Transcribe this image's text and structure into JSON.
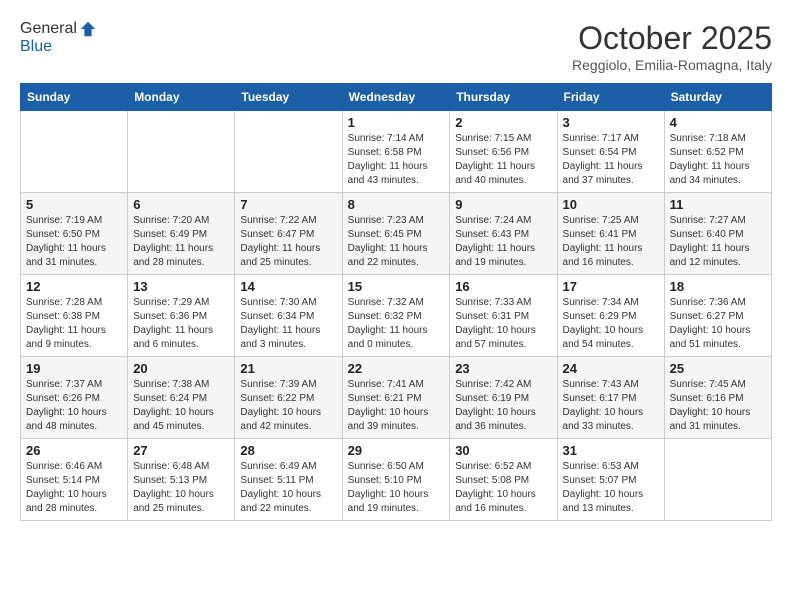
{
  "header": {
    "logo_line1": "General",
    "logo_line2": "Blue",
    "month": "October 2025",
    "location": "Reggiolo, Emilia-Romagna, Italy"
  },
  "days_of_week": [
    "Sunday",
    "Monday",
    "Tuesday",
    "Wednesday",
    "Thursday",
    "Friday",
    "Saturday"
  ],
  "weeks": [
    [
      {
        "day": "",
        "info": ""
      },
      {
        "day": "",
        "info": ""
      },
      {
        "day": "",
        "info": ""
      },
      {
        "day": "1",
        "info": "Sunrise: 7:14 AM\nSunset: 6:58 PM\nDaylight: 11 hours and 43 minutes."
      },
      {
        "day": "2",
        "info": "Sunrise: 7:15 AM\nSunset: 6:56 PM\nDaylight: 11 hours and 40 minutes."
      },
      {
        "day": "3",
        "info": "Sunrise: 7:17 AM\nSunset: 6:54 PM\nDaylight: 11 hours and 37 minutes."
      },
      {
        "day": "4",
        "info": "Sunrise: 7:18 AM\nSunset: 6:52 PM\nDaylight: 11 hours and 34 minutes."
      }
    ],
    [
      {
        "day": "5",
        "info": "Sunrise: 7:19 AM\nSunset: 6:50 PM\nDaylight: 11 hours and 31 minutes."
      },
      {
        "day": "6",
        "info": "Sunrise: 7:20 AM\nSunset: 6:49 PM\nDaylight: 11 hours and 28 minutes."
      },
      {
        "day": "7",
        "info": "Sunrise: 7:22 AM\nSunset: 6:47 PM\nDaylight: 11 hours and 25 minutes."
      },
      {
        "day": "8",
        "info": "Sunrise: 7:23 AM\nSunset: 6:45 PM\nDaylight: 11 hours and 22 minutes."
      },
      {
        "day": "9",
        "info": "Sunrise: 7:24 AM\nSunset: 6:43 PM\nDaylight: 11 hours and 19 minutes."
      },
      {
        "day": "10",
        "info": "Sunrise: 7:25 AM\nSunset: 6:41 PM\nDaylight: 11 hours and 16 minutes."
      },
      {
        "day": "11",
        "info": "Sunrise: 7:27 AM\nSunset: 6:40 PM\nDaylight: 11 hours and 12 minutes."
      }
    ],
    [
      {
        "day": "12",
        "info": "Sunrise: 7:28 AM\nSunset: 6:38 PM\nDaylight: 11 hours and 9 minutes."
      },
      {
        "day": "13",
        "info": "Sunrise: 7:29 AM\nSunset: 6:36 PM\nDaylight: 11 hours and 6 minutes."
      },
      {
        "day": "14",
        "info": "Sunrise: 7:30 AM\nSunset: 6:34 PM\nDaylight: 11 hours and 3 minutes."
      },
      {
        "day": "15",
        "info": "Sunrise: 7:32 AM\nSunset: 6:32 PM\nDaylight: 11 hours and 0 minutes."
      },
      {
        "day": "16",
        "info": "Sunrise: 7:33 AM\nSunset: 6:31 PM\nDaylight: 10 hours and 57 minutes."
      },
      {
        "day": "17",
        "info": "Sunrise: 7:34 AM\nSunset: 6:29 PM\nDaylight: 10 hours and 54 minutes."
      },
      {
        "day": "18",
        "info": "Sunrise: 7:36 AM\nSunset: 6:27 PM\nDaylight: 10 hours and 51 minutes."
      }
    ],
    [
      {
        "day": "19",
        "info": "Sunrise: 7:37 AM\nSunset: 6:26 PM\nDaylight: 10 hours and 48 minutes."
      },
      {
        "day": "20",
        "info": "Sunrise: 7:38 AM\nSunset: 6:24 PM\nDaylight: 10 hours and 45 minutes."
      },
      {
        "day": "21",
        "info": "Sunrise: 7:39 AM\nSunset: 6:22 PM\nDaylight: 10 hours and 42 minutes."
      },
      {
        "day": "22",
        "info": "Sunrise: 7:41 AM\nSunset: 6:21 PM\nDaylight: 10 hours and 39 minutes."
      },
      {
        "day": "23",
        "info": "Sunrise: 7:42 AM\nSunset: 6:19 PM\nDaylight: 10 hours and 36 minutes."
      },
      {
        "day": "24",
        "info": "Sunrise: 7:43 AM\nSunset: 6:17 PM\nDaylight: 10 hours and 33 minutes."
      },
      {
        "day": "25",
        "info": "Sunrise: 7:45 AM\nSunset: 6:16 PM\nDaylight: 10 hours and 31 minutes."
      }
    ],
    [
      {
        "day": "26",
        "info": "Sunrise: 6:46 AM\nSunset: 5:14 PM\nDaylight: 10 hours and 28 minutes."
      },
      {
        "day": "27",
        "info": "Sunrise: 6:48 AM\nSunset: 5:13 PM\nDaylight: 10 hours and 25 minutes."
      },
      {
        "day": "28",
        "info": "Sunrise: 6:49 AM\nSunset: 5:11 PM\nDaylight: 10 hours and 22 minutes."
      },
      {
        "day": "29",
        "info": "Sunrise: 6:50 AM\nSunset: 5:10 PM\nDaylight: 10 hours and 19 minutes."
      },
      {
        "day": "30",
        "info": "Sunrise: 6:52 AM\nSunset: 5:08 PM\nDaylight: 10 hours and 16 minutes."
      },
      {
        "day": "31",
        "info": "Sunrise: 6:53 AM\nSunset: 5:07 PM\nDaylight: 10 hours and 13 minutes."
      },
      {
        "day": "",
        "info": ""
      }
    ]
  ]
}
